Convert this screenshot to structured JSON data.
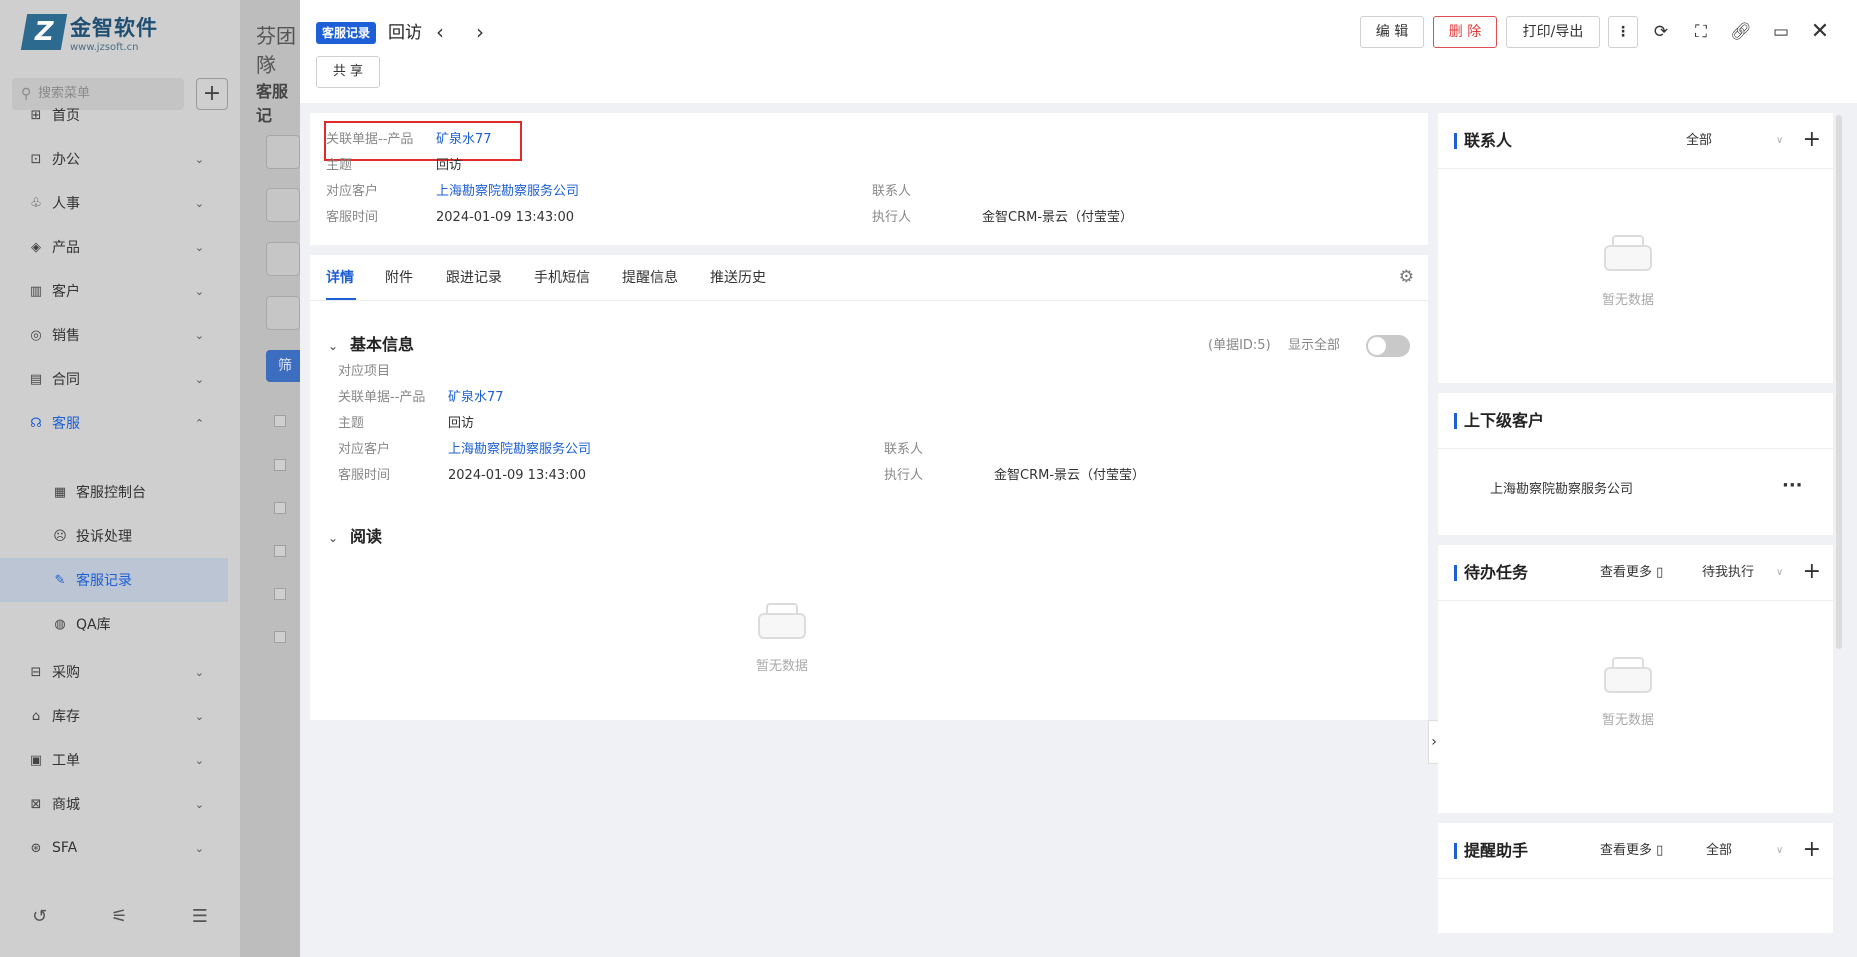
{
  "logo": {
    "name": "金智软件",
    "url": "www.jzsoft.cn"
  },
  "sidebar": {
    "search_placeholder": "搜索菜单",
    "items": [
      {
        "icon": "home-icon",
        "glyph": "⊞",
        "label": "首页"
      },
      {
        "icon": "office-icon",
        "glyph": "⊡",
        "label": "办公"
      },
      {
        "icon": "hr-icon",
        "glyph": "♧",
        "label": "人事"
      },
      {
        "icon": "product-icon",
        "glyph": "◈",
        "label": "产品"
      },
      {
        "icon": "customer-icon",
        "glyph": "▥",
        "label": "客户"
      },
      {
        "icon": "sales-icon",
        "glyph": "◎",
        "label": "销售"
      },
      {
        "icon": "contract-icon",
        "glyph": "▤",
        "label": "合同"
      },
      {
        "icon": "service-icon",
        "glyph": "☊",
        "label": "客服"
      },
      {
        "icon": "console-icon",
        "glyph": "▦",
        "label": "客服控制台"
      },
      {
        "icon": "complaint-icon",
        "glyph": "☹",
        "label": "投诉处理"
      },
      {
        "icon": "record-icon",
        "glyph": "✎",
        "label": "客服记录"
      },
      {
        "icon": "qa-icon",
        "glyph": "◍",
        "label": "QA库"
      },
      {
        "icon": "purchase-icon",
        "glyph": "⊟",
        "label": "采购"
      },
      {
        "icon": "stock-icon",
        "glyph": "⌂",
        "label": "库存"
      },
      {
        "icon": "workorder-icon",
        "glyph": "▣",
        "label": "工单"
      },
      {
        "icon": "mall-icon",
        "glyph": "⊠",
        "label": "商城"
      },
      {
        "icon": "sfa-icon",
        "glyph": "⊛",
        "label": "SFA"
      }
    ]
  },
  "under": {
    "title": "芬团隊",
    "subtitle": "客服记",
    "filter_btn": "筛"
  },
  "drawer": {
    "tag": "客服记录",
    "title": "回访",
    "share": "共 享",
    "edit": "编 辑",
    "delete": "删 除",
    "print": "打印/导出"
  },
  "header_info": {
    "related_label": "关联单据--产品",
    "related_value": "矿泉水77",
    "subject_label": "主题",
    "subject_value": "回访",
    "customer_label": "对应客户",
    "customer_value": "上海勘察院勘察服务公司",
    "contact_label": "联系人",
    "contact_value": "",
    "time_label": "客服时间",
    "time_value": "2024-01-09 13:43:00",
    "executor_label": "执行人",
    "executor_value": "金智CRM-景云（付莹莹）"
  },
  "tabs": [
    "详情",
    "附件",
    "跟进记录",
    "手机短信",
    "提醒信息",
    "推送历史"
  ],
  "basic": {
    "title": "基本信息",
    "doc_id": "(单据ID:5)",
    "show_all": "显示全部",
    "project_label": "对应项目",
    "related_label": "关联单据--产品",
    "related_value": "矿泉水77",
    "subject_label": "主题",
    "subject_value": "回访",
    "customer_label": "对应客户",
    "customer_value": "上海勘察院勘察服务公司",
    "contact_label": "联系人",
    "time_label": "客服时间",
    "time_value": "2024-01-09 13:43:00",
    "executor_label": "执行人",
    "executor_value": "金智CRM-景云（付莹莹）"
  },
  "read": {
    "title": "阅读",
    "empty": "暂无数据"
  },
  "right": {
    "contacts": {
      "title": "联系人",
      "filter": "全部",
      "empty": "暂无数据"
    },
    "hierarchy": {
      "title": "上下级客户",
      "item": "上海勘察院勘察服务公司"
    },
    "todo": {
      "title": "待办任务",
      "more": "查看更多",
      "filter": "待我执行",
      "empty": "暂无数据"
    },
    "reminder": {
      "title": "提醒助手",
      "more": "查看更多",
      "filter": "全部"
    }
  }
}
